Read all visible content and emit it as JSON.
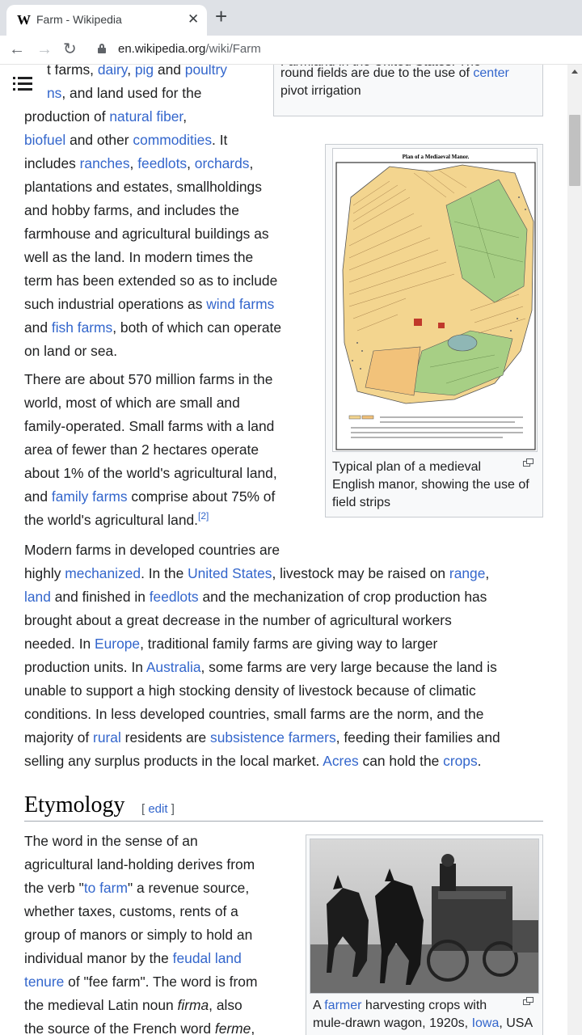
{
  "browser": {
    "tab_favicon": "W",
    "tab_title": "Farm - Wikipedia",
    "tab_close": "✕",
    "new_tab": "+",
    "back": "←",
    "forward": "→",
    "reload": "↻",
    "url_host": "en.wikipedia.org",
    "url_path": "/wiki/Farm"
  },
  "icons": [
    "menu-icon",
    "lock-icon",
    "magnify-icon"
  ],
  "intro_lines": [
    [
      {
        "t": "t farms, "
      },
      {
        "t": "dairy",
        "l": 1
      },
      {
        "t": ", "
      },
      {
        "t": "pig",
        "l": 1
      },
      {
        "t": " and "
      },
      {
        "t": "poultry",
        "l": 1
      }
    ],
    [
      {
        "t": "ns",
        "l": 1
      },
      {
        "t": ", and land used for the"
      }
    ],
    [
      {
        "t": "production of "
      },
      {
        "t": "natural fiber",
        "l": 1
      },
      {
        "t": ","
      }
    ],
    [
      {
        "t": "biofuel",
        "l": 1
      },
      {
        "t": " and other "
      },
      {
        "t": "commodities",
        "l": 1
      },
      {
        "t": ". It"
      }
    ],
    [
      {
        "t": "includes "
      },
      {
        "t": "ranches",
        "l": 1
      },
      {
        "t": ", "
      },
      {
        "t": "feedlots",
        "l": 1
      },
      {
        "t": ", "
      },
      {
        "t": "orchards",
        "l": 1
      },
      {
        "t": ","
      }
    ],
    [
      {
        "t": "plantations and estates, smallholdings"
      }
    ],
    [
      {
        "t": "and hobby farms, and includes the"
      }
    ],
    [
      {
        "t": "farmhouse and agricultural buildings as"
      }
    ],
    [
      {
        "t": "well as the land. In modern times the"
      }
    ],
    [
      {
        "t": "term has been extended so as to include"
      }
    ],
    [
      {
        "t": "such industrial operations as "
      },
      {
        "t": "wind farms",
        "l": 1
      }
    ],
    [
      {
        "t": "and "
      },
      {
        "t": "fish farms",
        "l": 1
      },
      {
        "t": ", both of which can operate"
      }
    ],
    [
      {
        "t": "on land or sea."
      }
    ]
  ],
  "para2_lines": [
    [
      {
        "t": "There are about 570 million farms in the"
      }
    ],
    [
      {
        "t": "world, most of which are small and"
      }
    ],
    [
      {
        "t": "family-operated. Small farms with a land"
      }
    ],
    [
      {
        "t": "area of fewer than 2 hectares operate"
      }
    ],
    [
      {
        "t": "about 1% of the world's agricultural land,"
      }
    ],
    [
      {
        "t": "and "
      },
      {
        "t": "family farms",
        "l": 1
      },
      {
        "t": " comprise about 75% of"
      }
    ],
    [
      {
        "t": "the world's agricultural land."
      },
      {
        "t": "[2]",
        "l": 1,
        "s": 1
      }
    ]
  ],
  "para3_lines": [
    [
      {
        "t": "Modern farms in developed countries are"
      }
    ],
    [
      {
        "t": "highly "
      },
      {
        "t": "mechanized",
        "l": 1
      },
      {
        "t": ". In the "
      },
      {
        "t": "United States",
        "l": 1
      },
      {
        "t": ", livestock may be raised on "
      },
      {
        "t": "range",
        "l": 1
      },
      {
        "t": ","
      }
    ],
    [
      {
        "t": "land",
        "l": 1
      },
      {
        "t": " and finished in "
      },
      {
        "t": "feedlots",
        "l": 1
      },
      {
        "t": " and the mechanization of crop production has"
      }
    ],
    [
      {
        "t": "brought about a great decrease in the number of agricultural workers"
      }
    ],
    [
      {
        "t": "needed. In "
      },
      {
        "t": "Europe",
        "l": 1
      },
      {
        "t": ", traditional family farms are giving way to larger"
      }
    ],
    [
      {
        "t": "production units. In "
      },
      {
        "t": "Australia",
        "l": 1
      },
      {
        "t": ", some farms are very large because the land is"
      }
    ],
    [
      {
        "t": "unable to support a high stocking density of livestock because of climatic"
      }
    ],
    [
      {
        "t": "conditions. In less developed countries, small farms are the norm, and the"
      }
    ],
    [
      {
        "t": "majority of "
      },
      {
        "t": "rural",
        "l": 1
      },
      {
        "t": " residents are "
      },
      {
        "t": "subsistence farmers",
        "l": 1
      },
      {
        "t": ", feeding their families and"
      }
    ],
    [
      {
        "t": "selling any surplus products in the local market. "
      },
      {
        "t": "Acres",
        "l": 1
      },
      {
        "t": " can hold the "
      },
      {
        "t": "crops",
        "l": 1
      },
      {
        "t": "."
      }
    ]
  ],
  "etym_lines": [
    [
      {
        "t": "The word in the sense of an"
      }
    ],
    [
      {
        "t": "agricultural land-holding derives from"
      }
    ],
    [
      {
        "t": "the verb \""
      },
      {
        "t": "to farm",
        "l": 1
      },
      {
        "t": "\" a revenue source,"
      }
    ],
    [
      {
        "t": "whether taxes, customs, rents of a"
      }
    ],
    [
      {
        "t": "group of manors or simply to hold an"
      }
    ],
    [
      {
        "t": "individual manor by the "
      },
      {
        "t": "feudal land",
        "l": 1
      }
    ],
    [
      {
        "t": "tenure",
        "l": 1
      },
      {
        "t": " of \"fee farm\". The word is from"
      }
    ],
    [
      {
        "t": "the medieval Latin noun "
      },
      {
        "t": "firma",
        "i": 1
      },
      {
        "t": ", also"
      }
    ],
    [
      {
        "t": "the source of the French word "
      },
      {
        "t": "ferme",
        "i": 1
      },
      {
        "t": ","
      }
    ]
  ],
  "top_caption": {
    "line1": "Farmland in the United States. The",
    "line2_text": "round fields are due to the use of ",
    "line2_link": "center",
    "line3_link": "pivot irrigation",
    "dash": "–"
  },
  "manor_figure": {
    "map_title": "Plan of a Mediaeval Manor.",
    "caption": [
      "Typical plan of a medieval",
      "English manor, showing the use of",
      "field strips"
    ]
  },
  "etymology": {
    "heading": "Etymology",
    "edit_open": "[ ",
    "edit_label": "edit",
    "edit_close": " ]"
  },
  "farmer_figure": {
    "caption_line1_pre": "A ",
    "caption_line1_link": "farmer",
    "caption_line1_post": " harvesting crops with",
    "caption_line2_pre": "mule-drawn wagon, 1920s, ",
    "caption_line2_link": "Iowa",
    "caption_line2_post": ", USA"
  }
}
